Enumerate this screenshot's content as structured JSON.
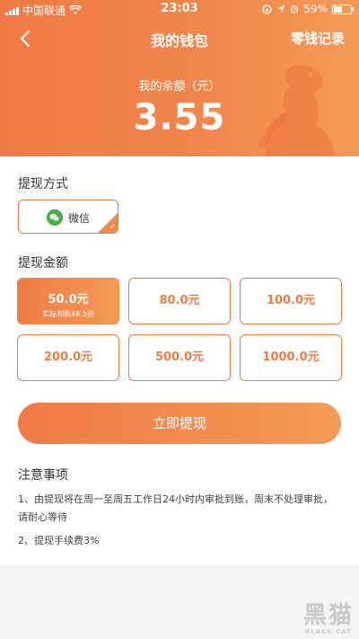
{
  "status": {
    "carrier": "中国联通",
    "time": "23:03",
    "battery": "59%",
    "battery_level": 0.59
  },
  "nav": {
    "title": "我的钱包",
    "right_link": "零钱记录"
  },
  "balance": {
    "label": "我的余额（元）",
    "amount": "3.55"
  },
  "withdraw_method": {
    "title": "提现方式",
    "option": "微信"
  },
  "withdraw_amount": {
    "title": "提现金额",
    "options": [
      {
        "value": "50.0元",
        "sub": "实际到账48.5元",
        "selected": true
      },
      {
        "value": "80.0元"
      },
      {
        "value": "100.0元"
      },
      {
        "value": "200.0元"
      },
      {
        "value": "500.0元"
      },
      {
        "value": "1000.0元"
      }
    ]
  },
  "submit_button": "立即提现",
  "notes": {
    "title": "注意事项",
    "items": [
      "1、由提现将在周一至周五工作日24小时内审批到账，周末不处理审批，请耐心等待",
      "2、提现手续费3%"
    ]
  },
  "watermark": {
    "main": "黑猫",
    "sub": "BLACK CAT"
  },
  "colors": {
    "accent": "#f07a45",
    "accent_light": "#f39a57",
    "wechat_green": "#3fb33f"
  }
}
